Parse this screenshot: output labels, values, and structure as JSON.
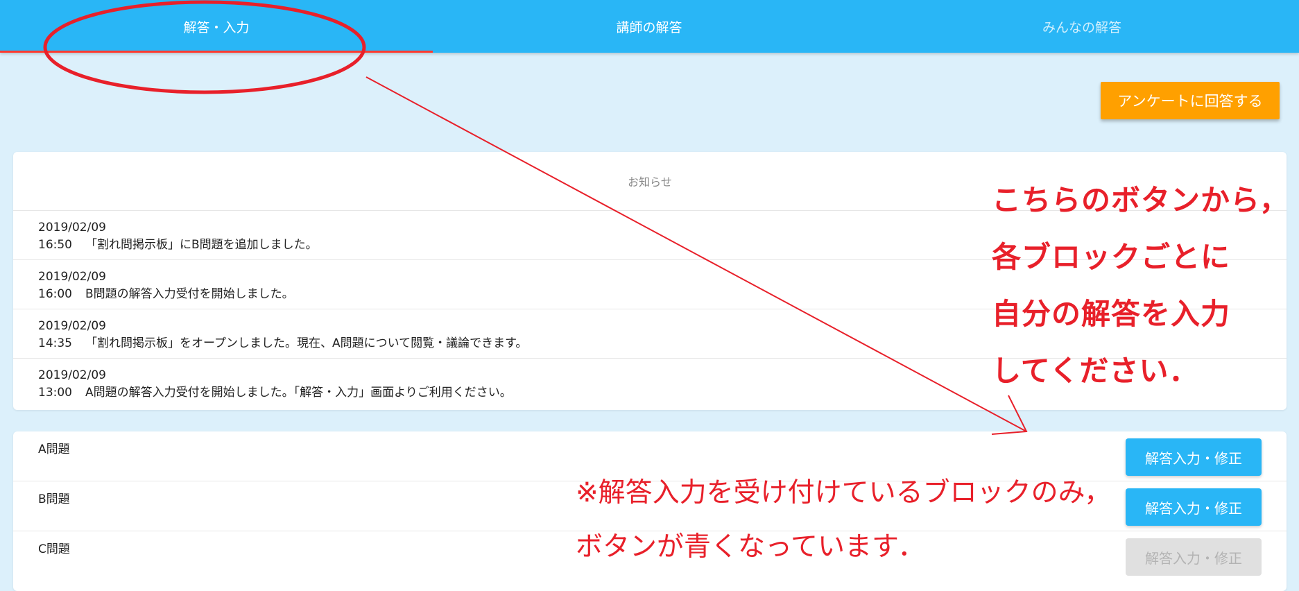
{
  "tabs": [
    {
      "label": "解答・入力",
      "active": true
    },
    {
      "label": "講師の解答",
      "active": false
    },
    {
      "label": "みんなの解答",
      "active": false
    }
  ],
  "survey_button": "アンケートに回答する",
  "news": {
    "title": "お知らせ",
    "items": [
      {
        "date": "2019/02/09",
        "time": "16:50",
        "text": "「割れ問掲示板」にB問題を追加しました。"
      },
      {
        "date": "2019/02/09",
        "time": "16:00",
        "text": "B問題の解答入力受付を開始しました。"
      },
      {
        "date": "2019/02/09",
        "time": "14:35",
        "text": "「割れ問掲示板」をオープンしました。現在、A問題について閲覧・議論できます。"
      },
      {
        "date": "2019/02/09",
        "time": "13:00",
        "text": "A問題の解答入力受付を開始しました。「解答・入力」画面よりご利用ください。"
      }
    ]
  },
  "problems": [
    {
      "label": "A問題",
      "button": "解答入力・修正",
      "enabled": true
    },
    {
      "label": "B問題",
      "button": "解答入力・修正",
      "enabled": true
    },
    {
      "label": "C問題",
      "button": "解答入力・修正",
      "enabled": false
    }
  ],
  "annotation": {
    "lines": [
      "こちらのボタンから，",
      "各ブロックごとに",
      "自分の解答を入力",
      "してください．"
    ],
    "note_lines": [
      "※解答入力を受け付けているブロックのみ，",
      "ボタンが青くなっています．"
    ],
    "color": "#e8202a"
  },
  "colors": {
    "accent": "#29b6f6",
    "survey": "#ffa000",
    "background": "#dcf0fb"
  }
}
